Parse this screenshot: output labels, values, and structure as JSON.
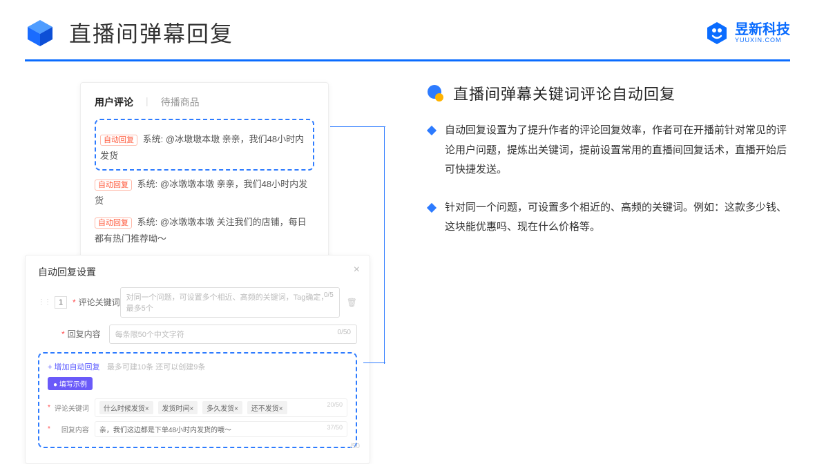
{
  "header": {
    "title": "直播间弹幕回复"
  },
  "brand": {
    "name": "昱新科技",
    "sub": "YUUXIN.COM"
  },
  "card1": {
    "tabs": {
      "active": "用户评论",
      "inactive": "待播商品"
    },
    "auto_tag": "自动回复",
    "sys_label": "系统:",
    "c1": "@冰墩墩本墩 亲亲，我们48小时内发货",
    "c2": "@冰墩墩本墩 亲亲，我们48小时内发货",
    "c3": "@冰墩墩本墩 关注我们的店铺，每日都有热门推荐呦～"
  },
  "card2": {
    "title": "自动回复设置",
    "num": "1",
    "label_kw": "评论关键词",
    "ph_kw": "对同一个问题，可设置多个相近、高频的关键词，Tag确定，最多5个",
    "cnt_kw": "0/5",
    "label_reply": "回复内容",
    "ph_reply": "每条限50个中文字符",
    "cnt_reply": "0/50",
    "add_link": "+ 增加自动回复",
    "add_hint": "最多可建10条 还可以创建9条",
    "example_badge": "● 填写示例",
    "ex_kw_label": "评论关键词",
    "chips": [
      "什么时候发货×",
      "发货时间×",
      "多久发货×",
      "还不发货×"
    ],
    "ex_kw_cnt": "20/50",
    "ex_reply_label": "回复内容",
    "ex_reply_val": "亲，我们这边都是下单48小时内发货的哦～",
    "ex_reply_cnt": "37/50",
    "stray_cnt": "/50"
  },
  "section": {
    "title": "直播间弹幕关键词评论自动回复",
    "b1": "自动回复设置为了提升作者的评论回复效率，作者可在开播前针对常见的评论用户问题，提炼出关键词，提前设置常用的直播间回复话术，直播开始后可快捷发送。",
    "b2": "针对同一个问题，可设置多个相近的、高频的关键词。例如：这款多少钱、这块能优惠吗、现在什么价格等。"
  }
}
